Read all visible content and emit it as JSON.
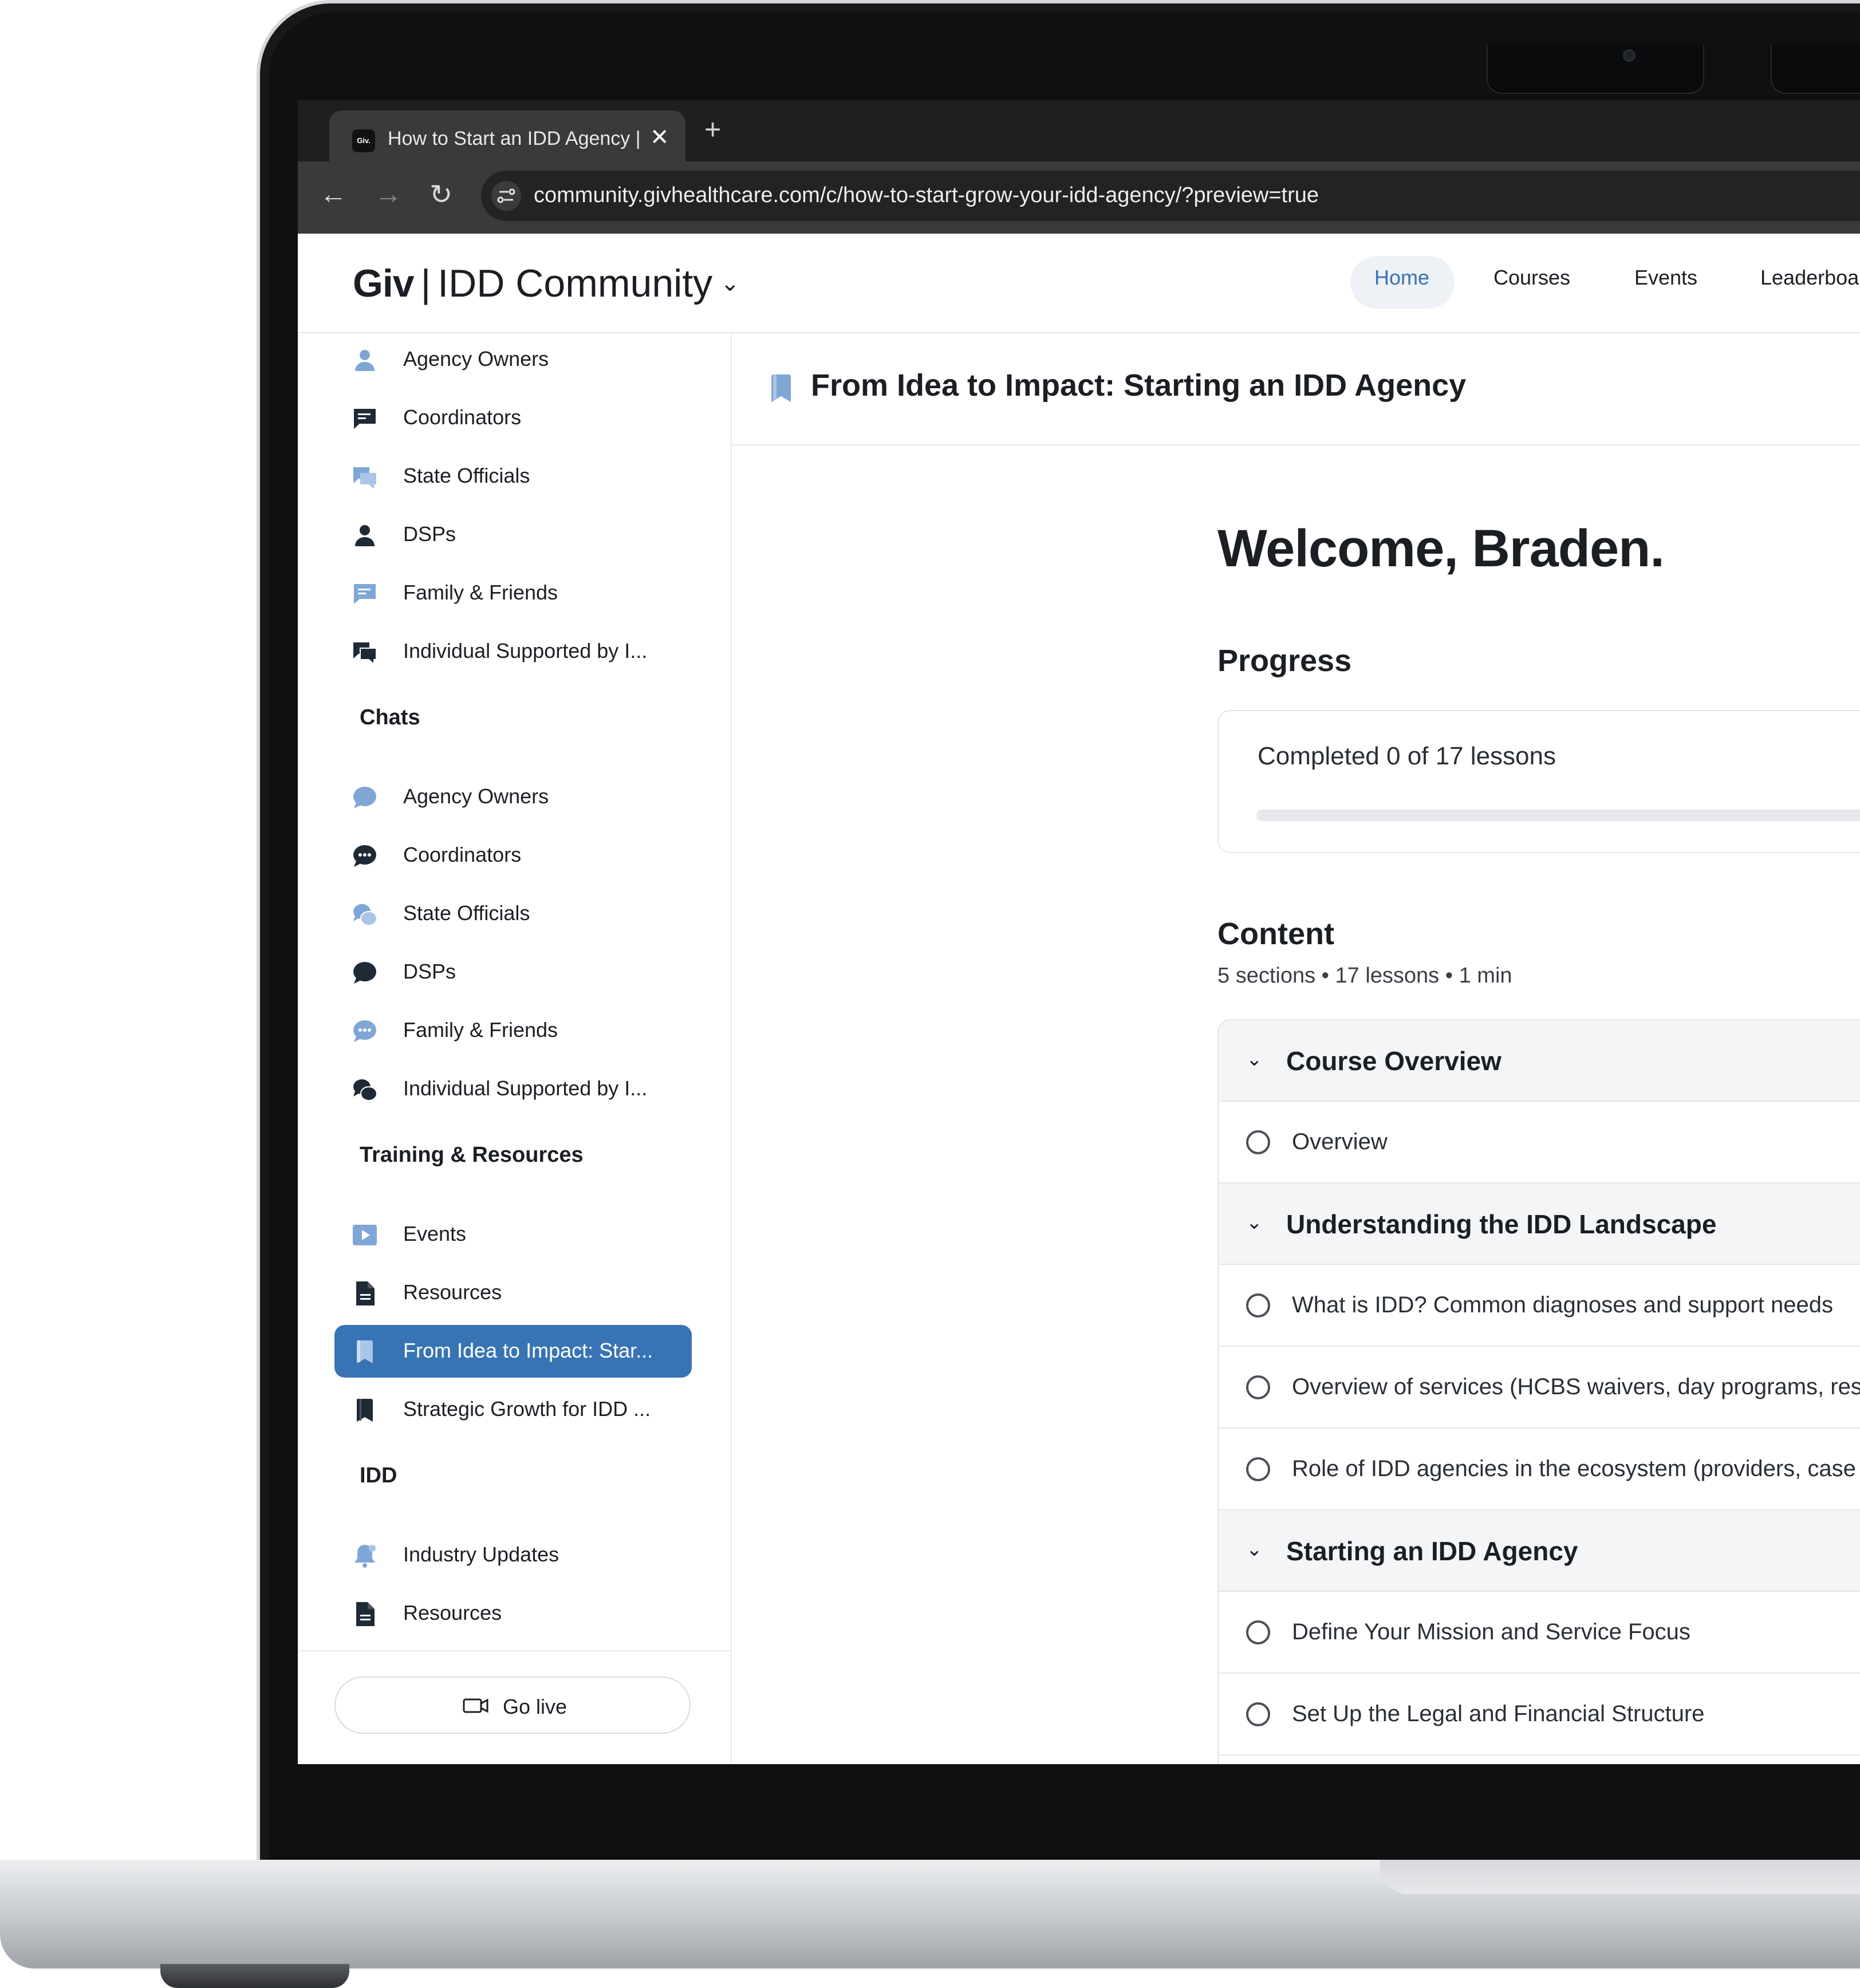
{
  "browser": {
    "tab_favicon": "Giv.",
    "tab_title": "How to Start an IDD Agency |",
    "tab_close": "✕",
    "new_tab": "+",
    "back": "←",
    "forward": "→",
    "reload": "↻",
    "url": "community.givhealthcare.com/c/how-to-start-grow-your-idd-agency/?preview=true"
  },
  "header": {
    "brand_bold": "Giv",
    "brand_sep": "|",
    "brand_rest": "IDD Community",
    "chevron": "⌄",
    "nav": [
      "Home",
      "Courses",
      "Events",
      "Leaderboa"
    ]
  },
  "sidebar": {
    "spaces": [
      "Agency Owners",
      "Coordinators",
      "State Officials",
      "DSPs",
      "Family & Friends",
      "Individual Supported by I..."
    ],
    "chats_heading": "Chats",
    "chats": [
      "Agency Owners",
      "Coordinators",
      "State Officials",
      "DSPs",
      "Family & Friends",
      "Individual Supported by I..."
    ],
    "training_heading": "Training & Resources",
    "training": [
      "Events",
      "Resources",
      "From Idea to Impact: Star...",
      "Strategic Growth for IDD ..."
    ],
    "idd_heading": "IDD",
    "idd": [
      "Industry Updates",
      "Resources"
    ],
    "go_live": "Go live"
  },
  "main": {
    "space_title": "From Idea to Impact: Starting an IDD Agency",
    "welcome": "Welcome, Braden.",
    "progress_heading": "Progress",
    "progress_text": "Completed 0 of 17 lessons",
    "progress_fraction": 0,
    "content_heading": "Content",
    "content_meta": "5 sections • 17 lessons • 1 min",
    "sections": [
      {
        "title": "Course Overview",
        "lessons": [
          "Overview"
        ]
      },
      {
        "title": "Understanding the IDD Landscape",
        "lessons": [
          "What is IDD? Common diagnoses and support needs",
          "Overview of services (HCBS waivers, day programs, resi",
          "Role of IDD agencies in the ecosystem (providers, case m"
        ]
      },
      {
        "title": "Starting an IDD Agency",
        "lessons": [
          "Define Your Mission and Service Focus",
          "Set Up the Legal and Financial Structure"
        ]
      }
    ]
  },
  "colors": {
    "accent": "#3874b4",
    "icon_light": "#7ea7d6",
    "icon_dark": "#1f2a37",
    "text": "#1b1f24"
  }
}
